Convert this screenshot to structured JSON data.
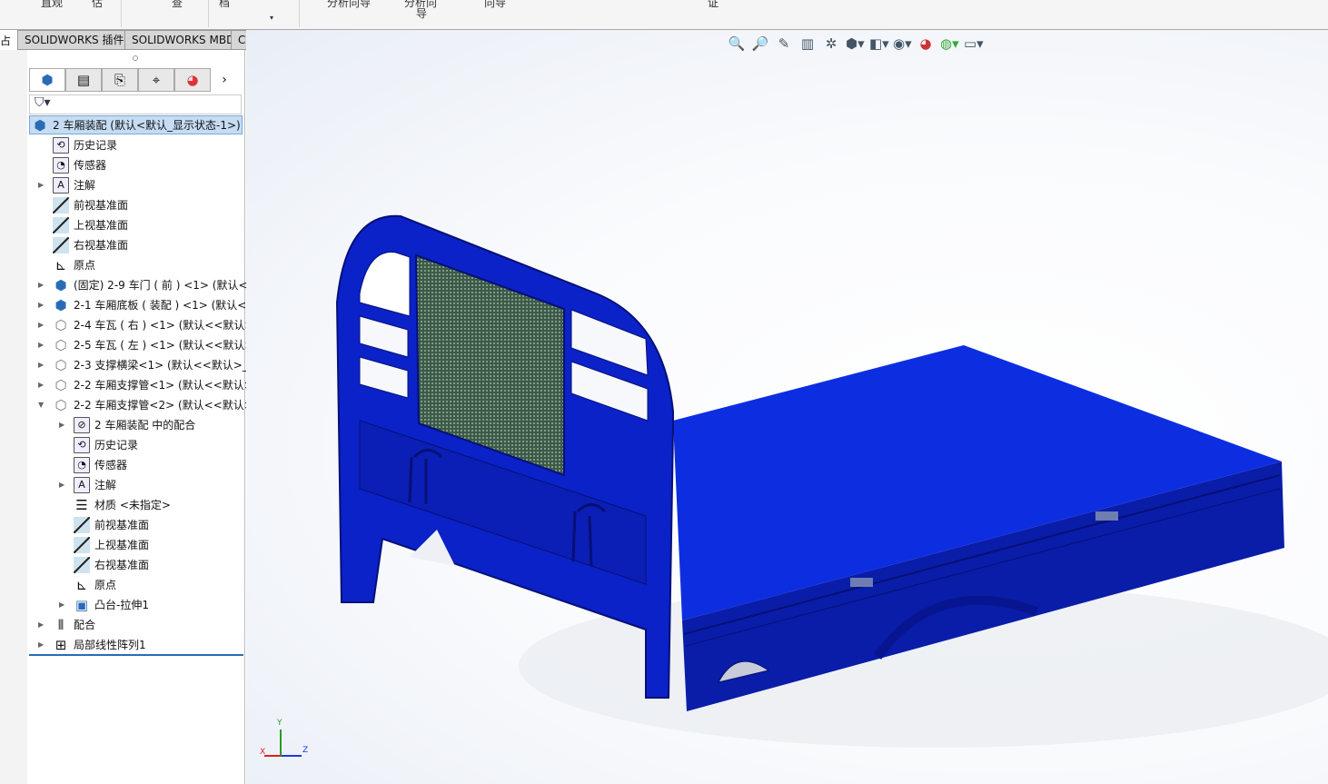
{
  "ribbon": {
    "labels": [
      "直观",
      "估",
      "查",
      "档",
      "▾",
      "分析向导",
      "分析向",
      "导",
      "向导",
      "证"
    ]
  },
  "tabs": [
    "SOLIDWORKS 插件",
    "SOLIDWORKS MBD",
    "CircuitWorks"
  ],
  "left_tab_partial": "占",
  "panel": {
    "tools": [
      "feature-manager",
      "property-manager",
      "configuration-manager",
      "dimxpert-manager",
      "display-manager"
    ],
    "filter_icon": "funnel-icon",
    "tree": [
      {
        "label": "2 车厢装配  (默认<默认_显示状态-1>)",
        "level": 0,
        "icon": "assembly",
        "arrow": "",
        "selected": true
      },
      {
        "label": "历史记录",
        "level": 1,
        "icon": "history",
        "arrow": ""
      },
      {
        "label": "传感器",
        "level": 1,
        "icon": "sensor",
        "arrow": ""
      },
      {
        "label": "注解",
        "level": 1,
        "icon": "annotation",
        "arrow": "right"
      },
      {
        "label": "前视基准面",
        "level": 1,
        "icon": "plane",
        "arrow": ""
      },
      {
        "label": "上视基准面",
        "level": 1,
        "icon": "plane",
        "arrow": ""
      },
      {
        "label": "右视基准面",
        "level": 1,
        "icon": "plane",
        "arrow": ""
      },
      {
        "label": "原点",
        "level": 1,
        "icon": "origin",
        "arrow": ""
      },
      {
        "label": "(固定) 2-9 车门 ( 前 ) <1> (默认<",
        "level": 1,
        "icon": "assembly",
        "arrow": "right"
      },
      {
        "label": "2-1 车厢底板 ( 装配 ) <1> (默认<",
        "level": 1,
        "icon": "assembly",
        "arrow": "right"
      },
      {
        "label": "2-4 车瓦 ( 右 ) <1> (默认<<默认>",
        "level": 1,
        "icon": "part",
        "arrow": "right"
      },
      {
        "label": "2-5 车瓦 ( 左 ) <1> (默认<<默认>",
        "level": 1,
        "icon": "part",
        "arrow": "right"
      },
      {
        "label": "2-3 支撑横梁<1> (默认<<默认>_",
        "level": 1,
        "icon": "part",
        "arrow": "right"
      },
      {
        "label": "2-2 车厢支撑管<1> (默认<<默认>",
        "level": 1,
        "icon": "part",
        "arrow": "right"
      },
      {
        "label": "2-2 车厢支撑管<2> (默认<<默认>",
        "level": 1,
        "icon": "part",
        "arrow": "down"
      },
      {
        "label": "2 车厢装配 中的配合",
        "level": 2,
        "icon": "mates-folder",
        "arrow": "right"
      },
      {
        "label": "历史记录",
        "level": 2,
        "icon": "history",
        "arrow": ""
      },
      {
        "label": "传感器",
        "level": 2,
        "icon": "sensor",
        "arrow": ""
      },
      {
        "label": "注解",
        "level": 2,
        "icon": "annotation",
        "arrow": "right"
      },
      {
        "label": "材质 <未指定>",
        "level": 2,
        "icon": "material",
        "arrow": ""
      },
      {
        "label": "前视基准面",
        "level": 2,
        "icon": "plane",
        "arrow": ""
      },
      {
        "label": "上视基准面",
        "level": 2,
        "icon": "plane",
        "arrow": ""
      },
      {
        "label": "右视基准面",
        "level": 2,
        "icon": "plane",
        "arrow": ""
      },
      {
        "label": "原点",
        "level": 2,
        "icon": "origin",
        "arrow": ""
      },
      {
        "label": "凸台-拉伸1",
        "level": 2,
        "icon": "extrude",
        "arrow": "right"
      },
      {
        "label": "配合",
        "level": 1,
        "icon": "mates",
        "arrow": "right"
      },
      {
        "label": "局部线性阵列1",
        "level": 1,
        "icon": "linear-pattern",
        "arrow": "right"
      }
    ]
  },
  "viewport": {
    "toolbar": [
      "zoom-to-fit",
      "zoom-area",
      "previous-view",
      "section-view",
      "dynamic-annotation",
      "view-orientation",
      "display-style",
      "hide-show",
      "edit-appearance",
      "apply-scene",
      "view-settings"
    ],
    "triad": {
      "x": "X",
      "y": "Y",
      "z": "Z"
    },
    "model_color": "#0a22c8"
  }
}
